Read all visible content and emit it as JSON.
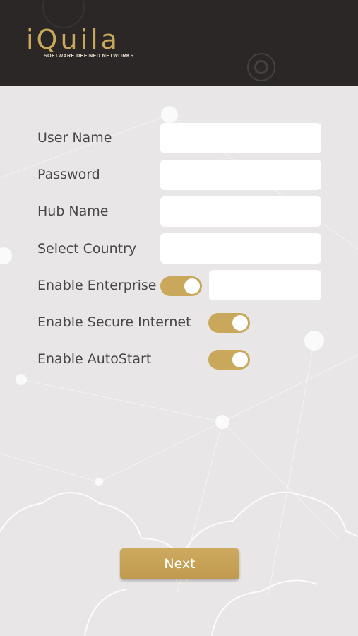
{
  "brand": {
    "logo": "iQuila",
    "tagline": "SOFTWARE DEFINED NETWORKS"
  },
  "form": {
    "username_label": "User Name",
    "username_value": "",
    "password_label": "Password",
    "password_value": "",
    "hub_label": "Hub Name",
    "hub_value": "",
    "country_label": "Select Country",
    "country_value": "",
    "enterprise_label": "Enable Enterprise",
    "enterprise_on": true,
    "enterprise_value": "",
    "secure_label": "Enable Secure Internet",
    "secure_on": true,
    "autostart_label": "Enable AutoStart",
    "autostart_on": true
  },
  "next_label": "Next",
  "colors": {
    "header_bg": "#2b2727",
    "accent": "#c9a85c",
    "background": "#e8e6e7"
  }
}
